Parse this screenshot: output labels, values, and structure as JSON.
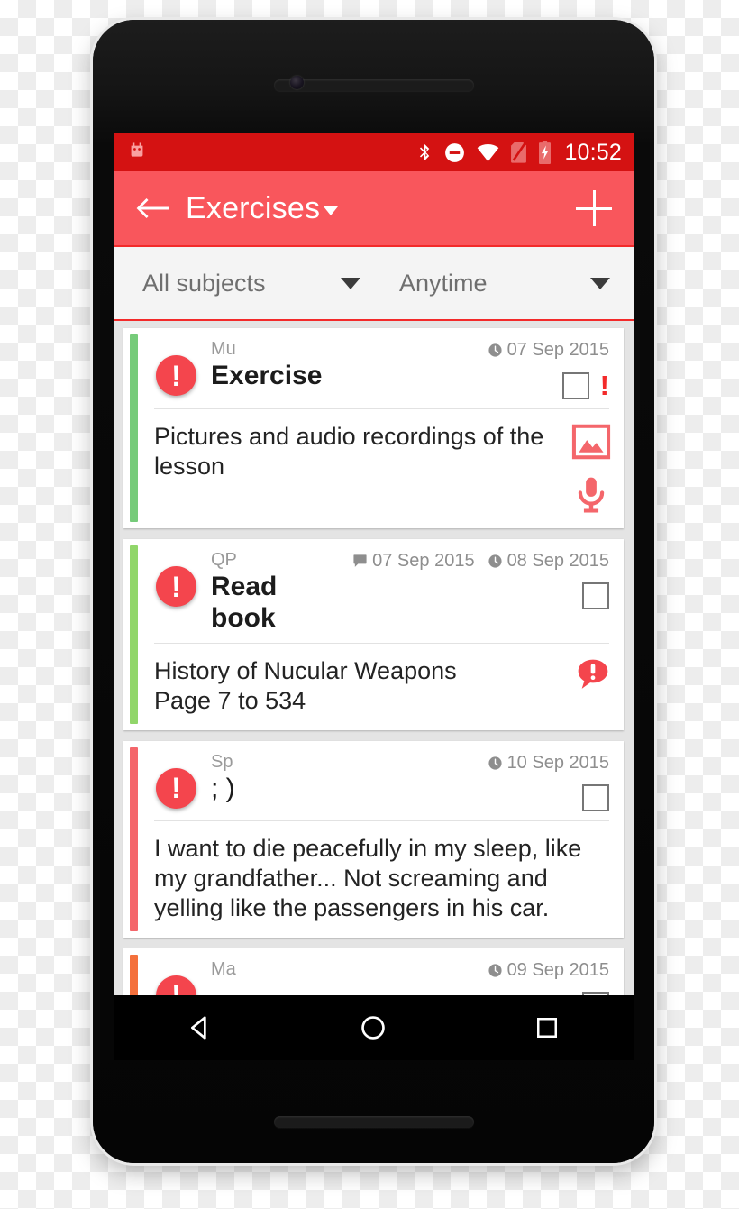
{
  "status_bar": {
    "time": "10:52",
    "icons": [
      "bluetooth-icon",
      "do-not-disturb-icon",
      "wifi-icon",
      "no-sim-icon",
      "battery-charging-icon"
    ],
    "background_color": "#d41212"
  },
  "app_bar": {
    "back_label": "back-arrow",
    "title": "Exercises",
    "caret": "dropdown-caret",
    "add_label": "add",
    "background_color": "#f9565c"
  },
  "filter_bar": {
    "subject_filter": "All subjects",
    "time_filter": "Anytime",
    "border_color": "#f32a2a"
  },
  "colors": {
    "stripe_green": "#76cb7a",
    "stripe_red": "#f4666b",
    "stripe_orange": "#f4703c",
    "accent_red": "#f4454d"
  },
  "cards": [
    {
      "subject": "Mu",
      "title": "Exercise",
      "dates": [
        {
          "icon": "clock-icon",
          "text": "07 Sep 2015"
        }
      ],
      "has_checkbox": true,
      "has_priority_bang": true,
      "content": "Pictures and audio recordings of the lesson",
      "actions": [
        "image-icon",
        "microphone-icon"
      ],
      "stripe": "#76cb7a"
    },
    {
      "subject": "QP",
      "title": "Read book",
      "dates": [
        {
          "icon": "comment-icon",
          "text": "07 Sep 2015"
        },
        {
          "icon": "clock-icon",
          "text": "08 Sep 2015"
        }
      ],
      "has_checkbox": true,
      "has_priority_bang": false,
      "content": "History of Nucular Weapons\nPage 7 to 534",
      "actions": [
        "comment-alert-icon"
      ],
      "stripe": "#91d66a"
    },
    {
      "subject": "Sp",
      "title": "; )",
      "dates": [
        {
          "icon": "clock-icon",
          "text": "10 Sep 2015"
        }
      ],
      "has_checkbox": true,
      "has_priority_bang": false,
      "content": "I want to die peacefully in my sleep, like my grandfather... Not screaming and yelling like the passengers in his car.",
      "actions": [],
      "stripe": "#f4666b"
    },
    {
      "subject": "Ma",
      "title": "",
      "dates": [
        {
          "icon": "clock-icon",
          "text": "09 Sep 2015"
        }
      ],
      "has_checkbox": false,
      "has_priority_bang": false,
      "content": "",
      "actions": [],
      "stripe": "#f4703c"
    }
  ],
  "nav_bar": {
    "back": "back-triangle",
    "home": "home-circle",
    "recents": "recents-square"
  }
}
